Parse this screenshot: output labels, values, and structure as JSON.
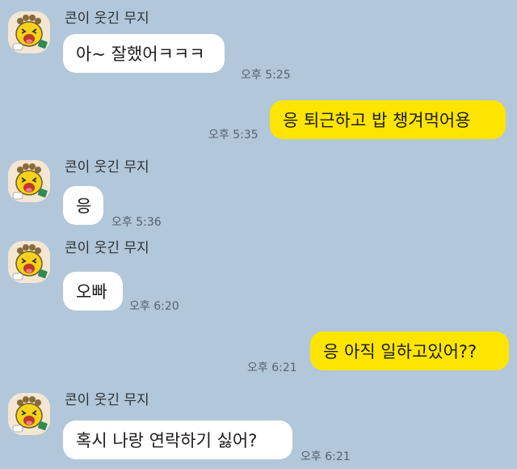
{
  "chat": {
    "theme": {
      "background": "#b2c7d9",
      "incoming_bubble": "#ffffff",
      "outgoing_bubble": "#fee500"
    },
    "messages": [
      {
        "id": 0,
        "direction": "incoming",
        "sender": "콘이 웃긴 무지",
        "avatar": "muzi-laughing-avatar",
        "text": "아~ 잘했어ㅋㅋㅋ",
        "time": "오후 5:25"
      },
      {
        "id": 1,
        "direction": "outgoing",
        "text": "응 퇴근하고 밥 챙겨먹어용",
        "time": "오후 5:35"
      },
      {
        "id": 2,
        "direction": "incoming",
        "sender": "콘이 웃긴 무지",
        "avatar": "muzi-laughing-avatar",
        "text": "응",
        "time": "오후 5:36"
      },
      {
        "id": 3,
        "direction": "incoming",
        "sender": "콘이 웃긴 무지",
        "avatar": "muzi-laughing-avatar",
        "text": "오빠",
        "time": "오후 6:20"
      },
      {
        "id": 4,
        "direction": "outgoing",
        "text": "응 아직 일하고있어??",
        "time": "오후 6:21"
      },
      {
        "id": 5,
        "direction": "incoming",
        "sender": "콘이 웃긴 무지",
        "avatar": "muzi-laughing-avatar",
        "text": "혹시 나랑 연락하기 싫어?",
        "time": "오후 6:21"
      }
    ]
  }
}
